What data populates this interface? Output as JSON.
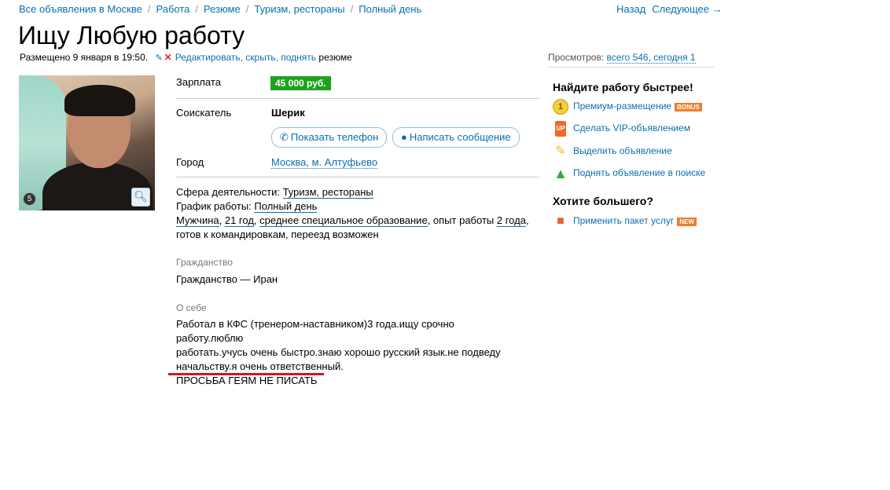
{
  "breadcrumbs": [
    "Все объявления в Москве",
    "Работа",
    "Резюме",
    "Туризм, рестораны",
    "Полный день"
  ],
  "nav": {
    "back": "Назад",
    "next": "Следующее →"
  },
  "title": "Ищу Любую работу",
  "meta": {
    "posted": "Размещено 9 января в 19:50.",
    "edit": "Редактировать, скрыть, поднять",
    "suffix": "резюме"
  },
  "views": {
    "label": "Просмотров:",
    "value": "всего 546, сегодня 1"
  },
  "photo": {
    "count": "5"
  },
  "salary": {
    "label": "Зарплата",
    "value": "45 000 руб."
  },
  "applicant": {
    "label": "Соискатель",
    "name": "Шерик"
  },
  "buttons": {
    "phone": "Показать телефон",
    "message": "Написать сообщение"
  },
  "city": {
    "label": "Город",
    "value": "Москва, м. Алтуфьево"
  },
  "details": {
    "sphere_label": "Сфера деятельности:",
    "sphere": "Туризм, рестораны",
    "schedule_label": "График работы:",
    "schedule": "Полный день",
    "gender": "Мужчина",
    "age": "21 год",
    "education": "среднее специальное образование",
    "exp_prefix": ", опыт работы",
    "exp": "2 года",
    "extra": "готов к командировкам, переезд возможен"
  },
  "citizenship": {
    "title": "Гражданство",
    "text": "Гражданство — Иран"
  },
  "about": {
    "title": "О себе",
    "lines": [
      "Работал в КФС (тренером-наставником)3 года.ищу срочно работу.люблю",
      "работать.учусь очень быстро.знаю хорошо русский язык.не подведу",
      "начальству.я очень ответственный.",
      "ПРОСЬБА ГЕЯМ НЕ ПИСАТЬ"
    ]
  },
  "sidebar": {
    "heading1": "Найдите работу быстрее!",
    "items": [
      {
        "label": "Премиум-размещение",
        "badge": "BONUS",
        "icon": "coin-icon",
        "color": "#f0c020"
      },
      {
        "label": "Сделать VIP-объявлением",
        "icon": "vip-icon",
        "color": "#e8622a"
      },
      {
        "label": "Выделить объявление",
        "icon": "highlighter-icon",
        "color": "#f2d21a"
      },
      {
        "label": "Поднять объявление в поиске",
        "icon": "arrow-up-icon",
        "color": "#4cb84c"
      }
    ],
    "heading2": "Хотите большего?",
    "package": {
      "label": "Применить пакет услуг",
      "badge": "NEW"
    }
  },
  "colors": {
    "link": "#0a6fb0",
    "price_bg": "#1fa21f",
    "badge_bonus": "#f07c2a",
    "badge_new": "#f07c2a",
    "underline_red": "#d8131b"
  }
}
